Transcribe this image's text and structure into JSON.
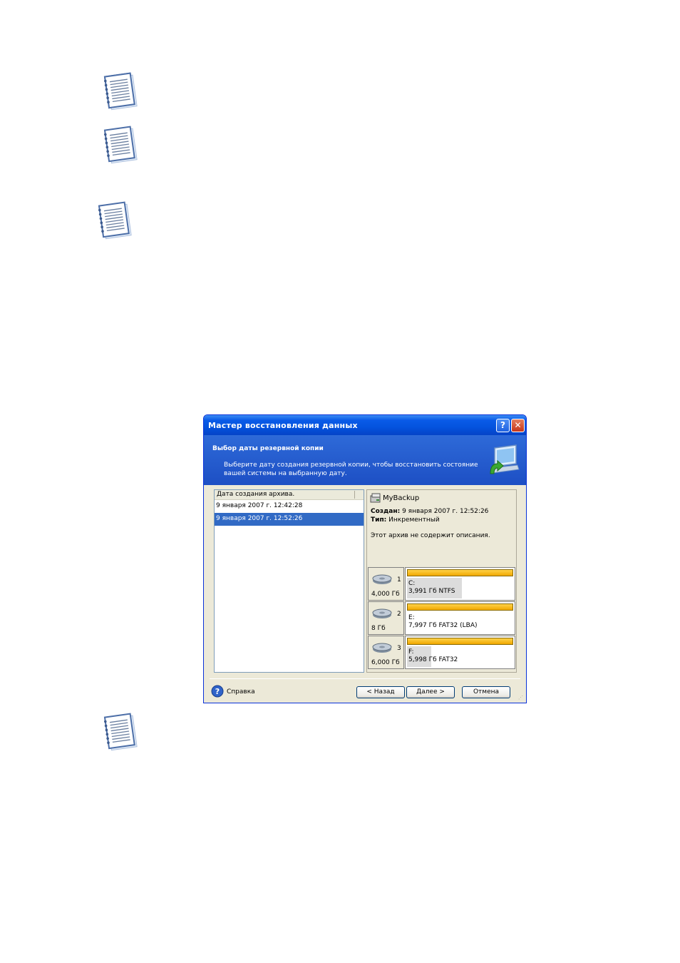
{
  "notes": [
    {
      "icon": "notepad-note-icon"
    },
    {
      "icon": "notepad-note-icon"
    },
    {
      "icon": "notepad-note-icon"
    },
    {
      "icon": "notepad-note-icon"
    }
  ],
  "dialog": {
    "title": "Мастер восстановления данных",
    "help_glyph": "?",
    "close_glyph": "✕",
    "header": {
      "title": "Выбор даты резервной копии",
      "description": "Выберите дату создания резервной копии, чтобы восстановить состояние вашей системы на выбранную дату."
    },
    "list": {
      "column_header": "Дата создания архива.",
      "rows": [
        {
          "label": "9 января 2007 г. 12:42:28",
          "selected": false
        },
        {
          "label": "9 января 2007 г. 12:52:26",
          "selected": true
        }
      ]
    },
    "archive": {
      "name": "MyBackup",
      "created_label": "Создан:",
      "created_value": "9 января 2007 г. 12:52:26",
      "type_label": "Тип:",
      "type_value": "Инкрементный",
      "description_text": "Этот архив не содержит описания."
    },
    "disks": [
      {
        "number": "1",
        "size": "4,000 Гб",
        "letter": "C:",
        "info": "3,991 Гб  NTFS",
        "used_fraction": 0.52
      },
      {
        "number": "2",
        "size": "8 Гб",
        "letter": "E:",
        "info": "7,997 Гб  FAT32 (LBA)",
        "used_fraction": 0.0
      },
      {
        "number": "3",
        "size": "6,000 Гб",
        "letter": "F:",
        "info": "5,998 Гб  FAT32",
        "used_fraction": 0.23
      }
    ],
    "footer": {
      "help_label": "Справка",
      "back_label": "< Назад",
      "next_label": "Далее >",
      "cancel_label": "Отмена"
    },
    "colors": {
      "title_bar": "#0a5be8",
      "header_band": "#2e6ad8",
      "selection": "#316ac5",
      "disk_bar": "#f0a800"
    }
  }
}
